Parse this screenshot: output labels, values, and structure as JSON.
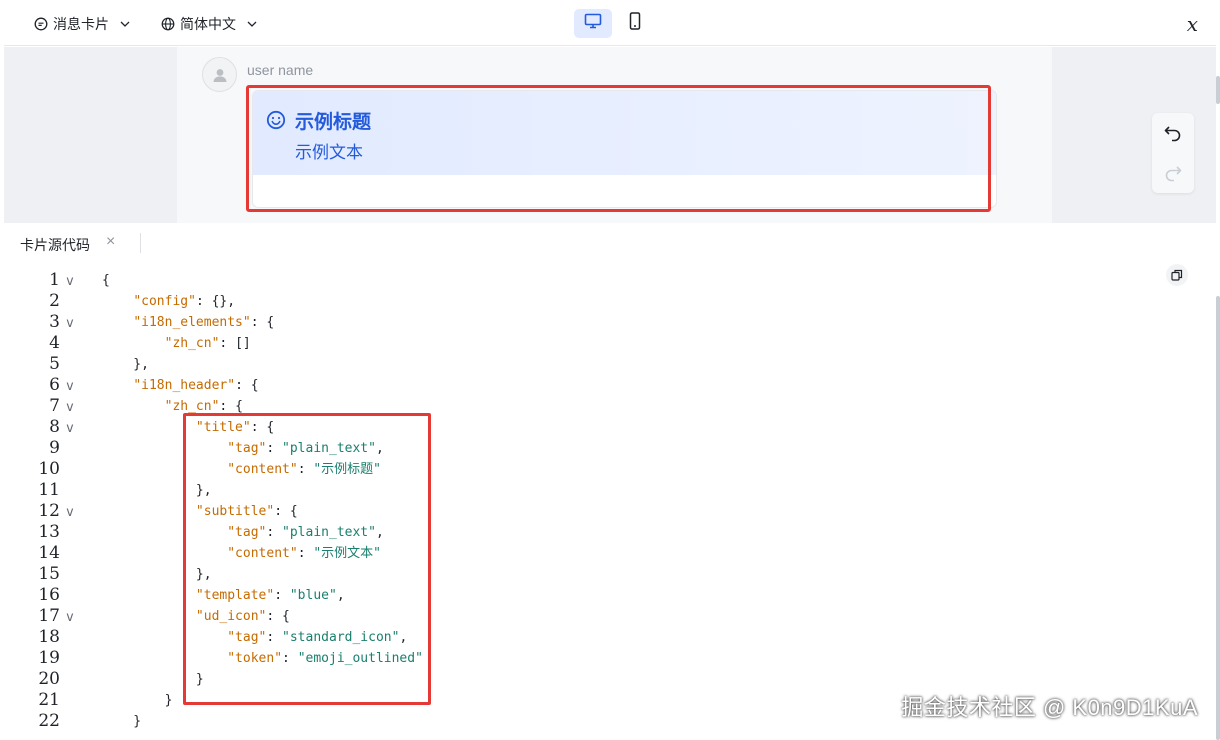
{
  "toolbar": {
    "card_type_label": "消息卡片",
    "language_label": "简体中文",
    "formula_symbol": "x"
  },
  "preview": {
    "username": "user name",
    "card": {
      "title": "示例标题",
      "subtitle": "示例文本",
      "template_color": "#245bdb",
      "icon": "emoji-outlined-icon"
    }
  },
  "code_panel": {
    "tab_label": "卡片源代码",
    "close_symbol": "×",
    "lines": [
      {
        "n": "1",
        "fold": true,
        "text": "{"
      },
      {
        "n": "2",
        "fold": false,
        "text": "    \"config\": {},"
      },
      {
        "n": "3",
        "fold": true,
        "text": "    \"i18n_elements\": {"
      },
      {
        "n": "4",
        "fold": false,
        "text": "        \"zh_cn\": []"
      },
      {
        "n": "5",
        "fold": false,
        "text": "    },"
      },
      {
        "n": "6",
        "fold": true,
        "text": "    \"i18n_header\": {"
      },
      {
        "n": "7",
        "fold": true,
        "text": "        \"zh_cn\": {"
      },
      {
        "n": "8",
        "fold": true,
        "text": "            \"title\": {"
      },
      {
        "n": "9",
        "fold": false,
        "text": "                \"tag\": \"plain_text\","
      },
      {
        "n": "10",
        "fold": false,
        "text": "                \"content\": \"示例标题\""
      },
      {
        "n": "11",
        "fold": false,
        "text": "            },"
      },
      {
        "n": "12",
        "fold": true,
        "text": "            \"subtitle\": {"
      },
      {
        "n": "13",
        "fold": false,
        "text": "                \"tag\": \"plain_text\","
      },
      {
        "n": "14",
        "fold": false,
        "text": "                \"content\": \"示例文本\""
      },
      {
        "n": "15",
        "fold": false,
        "text": "            },"
      },
      {
        "n": "16",
        "fold": false,
        "text": "            \"template\": \"blue\","
      },
      {
        "n": "17",
        "fold": true,
        "text": "            \"ud_icon\": {"
      },
      {
        "n": "18",
        "fold": false,
        "text": "                \"tag\": \"standard_icon\","
      },
      {
        "n": "19",
        "fold": false,
        "text": "                \"token\": \"emoji_outlined\""
      },
      {
        "n": "20",
        "fold": false,
        "text": "            }"
      },
      {
        "n": "21",
        "fold": false,
        "text": "        }"
      },
      {
        "n": "22",
        "fold": false,
        "text": "    }"
      }
    ]
  },
  "watermark": "掘金技术社区 @ K0n9D1KuA",
  "colors": {
    "highlight_box": "#e53935",
    "accent": "#245bdb",
    "json_key": "#c66b00",
    "json_string": "#1a7f6e"
  }
}
